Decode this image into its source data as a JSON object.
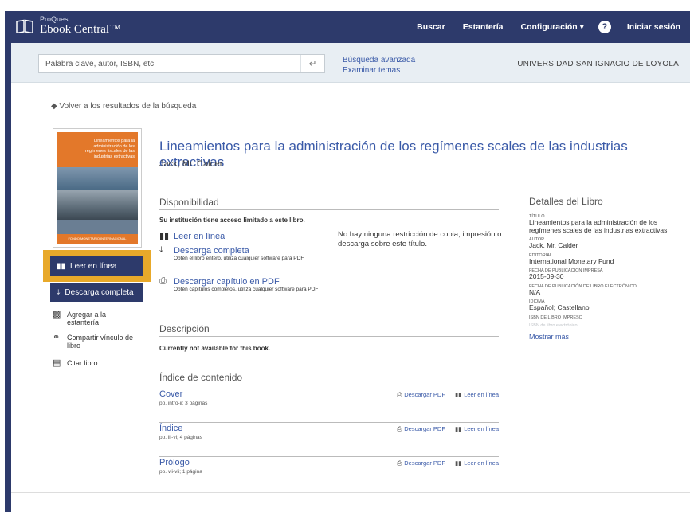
{
  "header": {
    "brand_small": "ProQuest",
    "brand_main": "Ebook Central™",
    "nav": {
      "buscar": "Buscar",
      "estanteria": "Estantería",
      "configuracion": "Configuración ▾",
      "help": "?",
      "login": "Iniciar sesión"
    }
  },
  "search": {
    "placeholder": "Palabra clave, autor, ISBN, etc.",
    "value": "",
    "go_icon": "enter-arrow-icon",
    "advanced": "Búsqueda avanzada",
    "topics": "Examinar temas",
    "institution": "UNIVERSIDAD SAN IGNACIO DE LOYOLA"
  },
  "back_link": "◆ Volver a los resultados de la búsqueda",
  "cover": {
    "title_text": "Lineamientos para la administración de los regímenes fiscales de las industrias extractivas",
    "footer_text": "FONDO MONETARIO INTERNACIONAL"
  },
  "actions": {
    "read_online": "Leer en línea",
    "download": "Descarga completa",
    "add_shelf": "Agregar a la estantería",
    "share_link": "Compartir vínculo de libro",
    "cite": "Citar libro"
  },
  "book": {
    "title": "Lineamientos para la administración de los regímenes scales de las industrias extractivas",
    "author": "Jack, Mr. Calder"
  },
  "availability": {
    "heading": "Disponibilidad",
    "note": "Su institución tiene acceso limitado a este libro.",
    "read_online": "Leer en línea",
    "download_full": "Descarga completa",
    "download_full_sub": "Obtén el libro entero, utiliza cualquier software para PDF",
    "download_chapter": "Descargar capítulo en PDF",
    "download_chapter_sub": "Obtén capítulos completos, utiliza cualquier software para PDF",
    "restriction": "No hay ninguna restricción de copia, impresión o descarga sobre este título."
  },
  "description": {
    "heading": "Descripción",
    "text": "Currently not available for this book."
  },
  "toc": {
    "heading": "Índice de contenido",
    "download_label": "Descargar PDF",
    "read_label": "Leer en línea",
    "items": [
      {
        "title": "Cover",
        "pages": "pp. intro-ii; 3 páginas"
      },
      {
        "title": "Índice",
        "pages": "pp. iii-vi; 4 páginas"
      },
      {
        "title": "Prólogo",
        "pages": "pp. vii-vii; 1 página"
      }
    ]
  },
  "details": {
    "heading": "Detalles del Libro",
    "fields": [
      {
        "label": "Título",
        "value": "Lineamientos para la administración de los regímenes scales de las industrias extractivas"
      },
      {
        "label": "Autor",
        "value": "Jack, Mr. Calder"
      },
      {
        "label": "Editorial",
        "value": "International Monetary Fund"
      },
      {
        "label": "Fecha de publicación impresa",
        "value": "2015-09-30"
      },
      {
        "label": "Fecha de publicación de libro electrónico",
        "value": "N/A"
      },
      {
        "label": "Idioma",
        "value": "Español; Castellano"
      }
    ],
    "isbn_print_label": "ISBN de libro impreso",
    "isbn_ebook_label": "ISBN de libro electrónico",
    "more": "Mostrar más"
  },
  "colors": {
    "header": "#2d3a6b",
    "link": "#3a5aa8",
    "highlight": "#e8a92a",
    "cover": "#e3782a"
  }
}
